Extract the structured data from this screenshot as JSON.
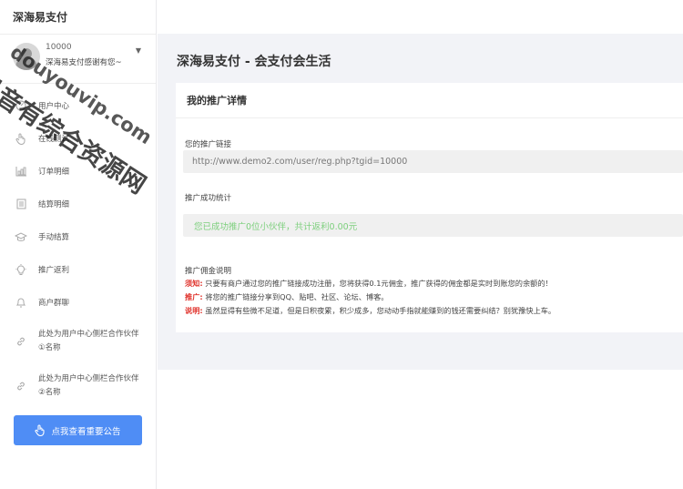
{
  "sidebar": {
    "brand": "深海易支付",
    "user": {
      "id": "10000",
      "name": "深海易支付感谢有您~"
    },
    "items": [
      {
        "label": "用户中心",
        "icon": "dashboard-icon"
      },
      {
        "label": "在线测试",
        "icon": "hand-pointer-icon"
      },
      {
        "label": "订单明细",
        "icon": "bar-chart-icon"
      },
      {
        "label": "结算明细",
        "icon": "document-icon"
      },
      {
        "label": "手动结算",
        "icon": "graduation-cap-icon"
      },
      {
        "label": "推广返利",
        "icon": "lightbulb-icon"
      },
      {
        "label": "商户群聊",
        "icon": "bell-icon"
      },
      {
        "label": "此处为用户中心侧栏合作伙伴①名称",
        "icon": "link-icon"
      },
      {
        "label": "此处为用户中心侧栏合作伙伴②名称",
        "icon": "link-icon"
      }
    ],
    "notice_button": "点我查看重要公告"
  },
  "main": {
    "page_title": "深海易支付 - 会支付会生活",
    "card": {
      "title": "我的推广详情",
      "link_label": "您的推广链接",
      "link_value": "http://www.demo2.com/user/reg.php?tgid=10000",
      "stat_label": "推广成功统计",
      "stat_value": "您已成功推广0位小伙伴，共计返利0.00元",
      "desc_label": "推广佣金说明",
      "desc": [
        {
          "tag": "须知:",
          "text": "只要有商户通过您的推广链接成功注册，您将获得0.1元佣金，推广获得的佣金都是实时到账您的余额的！"
        },
        {
          "tag": "推广:",
          "text": "将您的推广链接分享到QQ、贴吧、社区、论坛、博客。"
        },
        {
          "tag": "说明:",
          "text": "虽然显得有些微不足道，但是日积夜累，积少成多，您动动手指就能赚到的钱还需要纠结？别犹豫快上车。"
        }
      ]
    }
  },
  "watermark": {
    "line1": "抖音有综合资源网",
    "line2": "douyouvip.com"
  },
  "colors": {
    "accent": "#4f8df5",
    "success_text": "#7ccf7c",
    "tag_red": "#e0322b",
    "main_bg": "#f2f3f7"
  }
}
